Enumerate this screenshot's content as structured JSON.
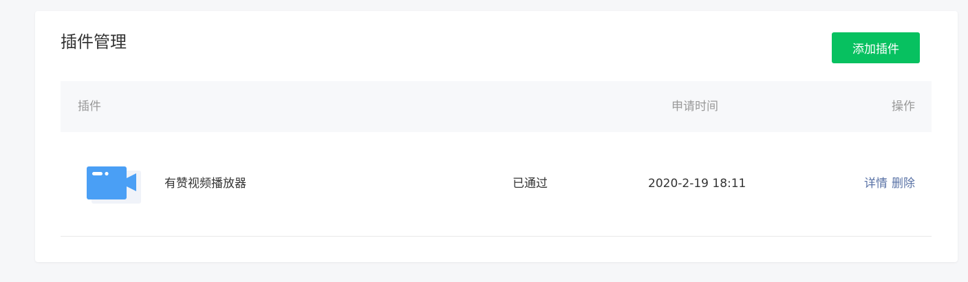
{
  "header": {
    "title": "插件管理",
    "add_button_label": "添加插件"
  },
  "colors": {
    "primary_button": "#07c160",
    "link": "#5a73a6",
    "icon_blue": "#4a9ff5"
  },
  "table": {
    "columns": {
      "plugin": "插件",
      "apply_time": "申请时间",
      "actions": "操作"
    },
    "rows": [
      {
        "icon": "video-camera-icon",
        "name": "有赞视频播放器",
        "status": "已通过",
        "apply_time": "2020-2-19 18:11",
        "actions": [
          "详情",
          "删除"
        ]
      }
    ]
  }
}
